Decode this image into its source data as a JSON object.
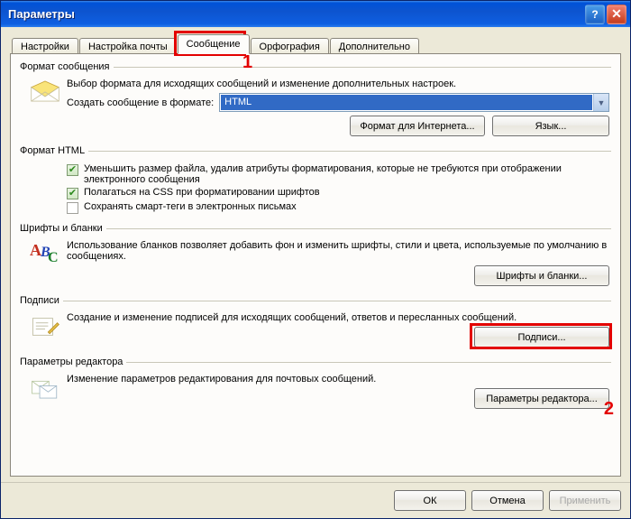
{
  "window": {
    "title": "Параметры"
  },
  "tabs": [
    {
      "label": "Настройки"
    },
    {
      "label": "Настройка почты"
    },
    {
      "label": "Сообщение"
    },
    {
      "label": "Орфография"
    },
    {
      "label": "Дополнительно"
    }
  ],
  "groups": {
    "format": {
      "legend": "Формат сообщения",
      "desc": "Выбор формата для исходящих сообщений и изменение дополнительных настроек.",
      "create_label": "Создать сообщение в формате:",
      "dropdown_value": "HTML",
      "btn_internet": "Формат для Интернета...",
      "btn_lang": "Язык..."
    },
    "html": {
      "legend": "Формат HTML",
      "check1": "Уменьшить размер файла, удалив атрибуты форматирования, которые не требуются при отображении электронного сообщения",
      "check2": "Полагаться на CSS при форматировании шрифтов",
      "check3": "Сохранять смарт-теги в электронных письмах"
    },
    "fonts": {
      "legend": "Шрифты и бланки",
      "desc": "Использование бланков позволяет добавить фон и изменить шрифты, стили и цвета, используемые по умолчанию в сообщениях.",
      "btn": "Шрифты и бланки..."
    },
    "sign": {
      "legend": "Подписи",
      "desc": "Создание и изменение подписей для исходящих сообщений, ответов и пересланных сообщений.",
      "btn": "Подписи..."
    },
    "editor": {
      "legend": "Параметры редактора",
      "desc": "Изменение параметров редактирования для почтовых сообщений.",
      "btn": "Параметры редактора..."
    }
  },
  "annotations": {
    "tab": "1",
    "sign": "2"
  },
  "buttons": {
    "ok": "ОК",
    "cancel": "Отмена",
    "apply": "Применить"
  }
}
